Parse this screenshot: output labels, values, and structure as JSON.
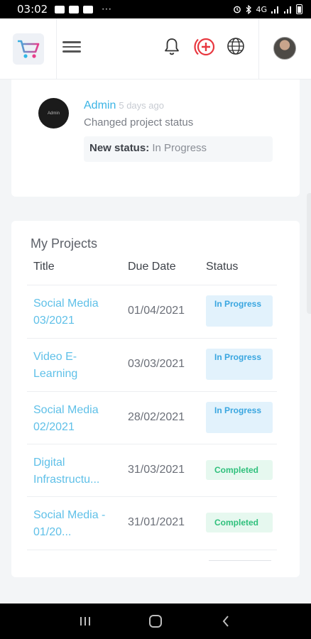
{
  "status_bar": {
    "time": "03:02",
    "more": "···",
    "network": "4G"
  },
  "header": {
    "menu_icon": "hamburger-icon",
    "notification_icon": "bell-icon",
    "add_icon": "plus-circle-icon",
    "language_icon": "globe-icon",
    "accent": "#e8373f"
  },
  "activity": {
    "avatar_text": "Admin",
    "user": "Admin",
    "time_ago": "5 days ago",
    "message": "Changed project status",
    "status_label": "New status:",
    "status_value": "In Progress"
  },
  "projects": {
    "title": "My Projects",
    "columns": [
      "Title",
      "Due Date",
      "Status"
    ],
    "rows": [
      {
        "title": "Social Media 03/2021",
        "due": "01/04/2021",
        "status": "In Progress",
        "status_kind": "progress"
      },
      {
        "title": "Video E-Learning",
        "due": "03/03/2021",
        "status": "In Progress",
        "status_kind": "progress"
      },
      {
        "title": "Social Media 02/2021",
        "due": "28/02/2021",
        "status": "In Progress",
        "status_kind": "progress"
      },
      {
        "title": "Digital Infrastructu...",
        "due": "31/03/2021",
        "status": "Completed",
        "status_kind": "done"
      },
      {
        "title": "Social Media - 01/20...",
        "due": "31/01/2021",
        "status": "Completed",
        "status_kind": "done"
      }
    ]
  },
  "colors": {
    "link": "#5fc0e8",
    "progress_bg": "#e2f2fc",
    "progress_fg": "#39a6e0",
    "done_bg": "#e6f8ef",
    "done_fg": "#2fc07c"
  }
}
